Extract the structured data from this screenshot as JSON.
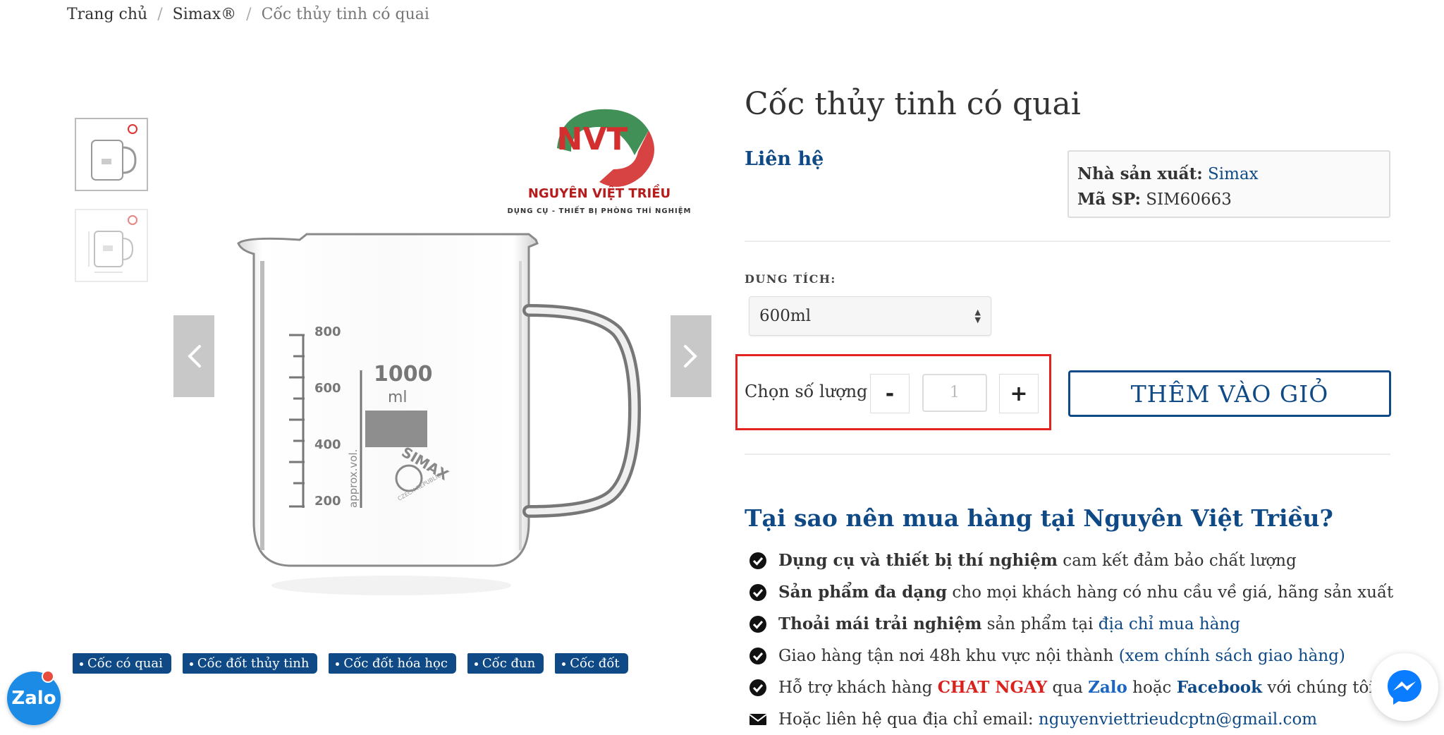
{
  "breadcrumb": {
    "home": "Trang chủ",
    "category": "Simax®",
    "current": "Cốc thủy tinh có quai"
  },
  "gallery": {
    "logo_initials": "NVT",
    "logo_name": "NGUYÊN VIỆT TRIỀU",
    "logo_tagline": "DỤNG CỤ - THIẾT BỊ PHÒNG THÍ NGHIỆM",
    "beaker_volume": "1000",
    "beaker_unit": "ml",
    "beaker_marks": [
      "800",
      "600",
      "400",
      "200"
    ],
    "beaker_side_text": "approx.vol.",
    "beaker_brand": "SIMAX",
    "beaker_origin": "CZECH REPUBLIC"
  },
  "tags": [
    "Cốc có quai",
    "Cốc đốt thủy tinh",
    "Cốc đốt hóa học",
    "Cốc đun",
    "Cốc đốt"
  ],
  "product": {
    "title": "Cốc thủy tinh có quai",
    "price": "Liên hệ",
    "manufacturer_label": "Nhà sản xuất:",
    "manufacturer": "Simax",
    "sku_label": "Mã SP:",
    "sku": "SIM60663"
  },
  "variant": {
    "label": "DUNG TÍCH:",
    "selected": "600ml"
  },
  "quantity": {
    "label": "Chọn số lượng",
    "minus": "-",
    "plus": "+",
    "value": "1"
  },
  "cart": {
    "add_label": "THÊM VÀO GIỎ"
  },
  "why": {
    "heading": "Tại sao nên mua hàng tại Nguyên Việt Triều?",
    "items": [
      {
        "bold": "Dụng cụ và thiết bị thí nghiệm",
        "text": " cam kết đảm bảo chất lượng"
      },
      {
        "bold": "Sản phẩm đa dạng",
        "text": " cho mọi khách hàng có nhu cầu về giá, hãng sản xuất"
      },
      {
        "bold": "Thoải mái trải nghiệm",
        "text": " sản phẩm tại ",
        "link": "địa chỉ mua hàng"
      },
      {
        "text": "Giao hàng tận nơi 48h khu vực nội thành ",
        "link": "(xem chính sách giao hàng)"
      },
      {
        "text": "Hỗ trợ khách hàng ",
        "chat": "CHAT NGAY",
        "text2": " qua ",
        "zalo": "Zalo",
        "text3": " hoặc ",
        "facebook": "Facebook",
        "text4": " với chúng tôi ↓"
      },
      {
        "text": "Hoặc liên hệ qua địa chỉ email: ",
        "link": "nguyenviettrieudcptn@gmail.com"
      }
    ]
  },
  "floating": {
    "zalo": "Zalo"
  },
  "colors": {
    "brand_blue": "#0f4a86",
    "highlight_red": "#e3231e",
    "tag_bg": "#0f4a86"
  }
}
